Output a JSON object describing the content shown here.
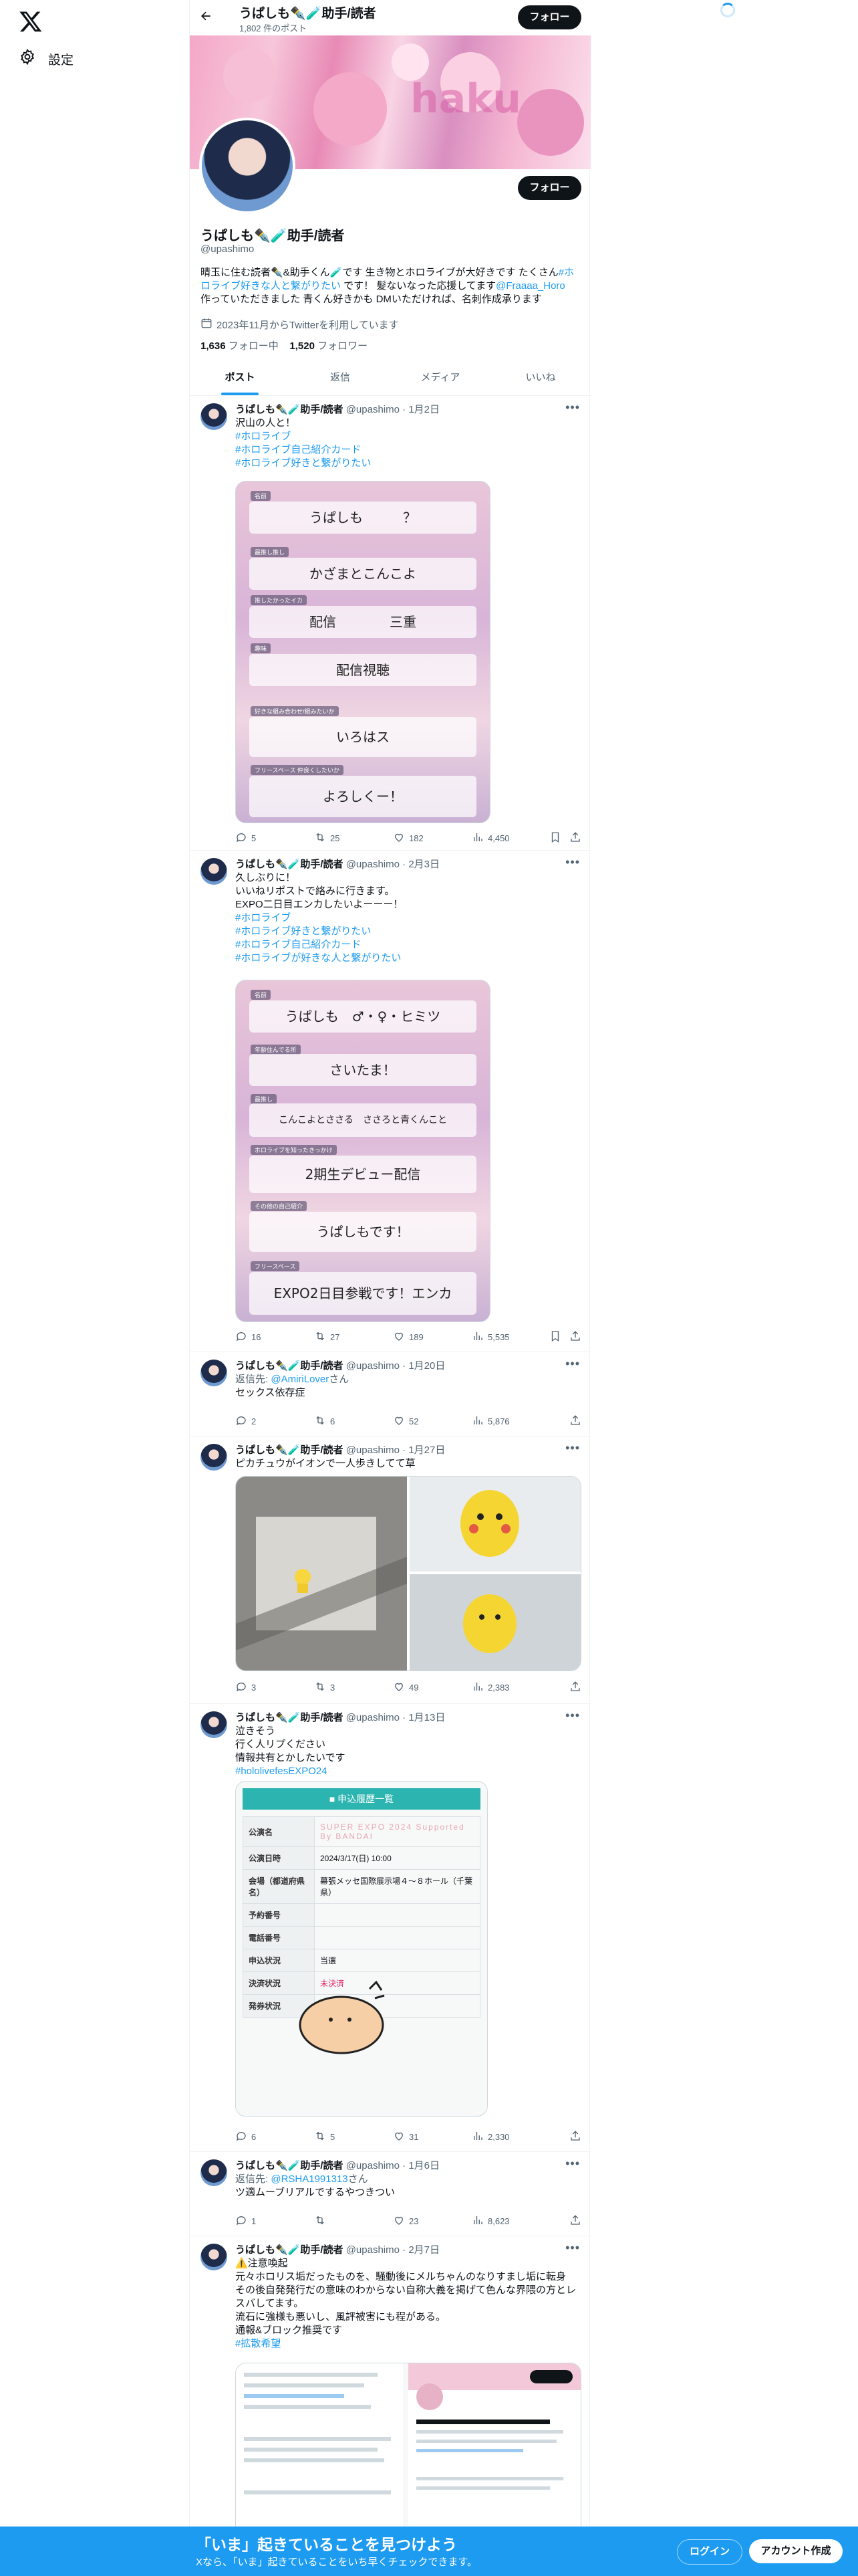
{
  "nav": {
    "settings_label": "設定"
  },
  "header": {
    "name": "うぱしも✒️🧪助手/読者",
    "posts_count": "1,802 件のポスト",
    "follow_label": "フォロー"
  },
  "profile": {
    "name": "うぱしも✒️🧪助手/読者",
    "handle": "@upashimo",
    "bio_1": "晴玉に住む読者✒️&助手くん🧪です 生き物とホロライブが大好きです たくさん",
    "bio_tag": "#ホロライブ好きな人と繋がりたい",
    "bio_2": " です！ 髪ないなった応援してます",
    "bio_mention": "@Fraaaa_Horo",
    "bio_3": "作っていただきました 青くん好きかも DMいただければ、名刺作成承ります",
    "joined": "2023年11月からTwitterを利用しています",
    "following_count": "1,636",
    "following_label": "フォロー中",
    "followers_count": "1,520",
    "followers_label": "フォロワー",
    "follow_label": "フォロー"
  },
  "tabs": [
    "ポスト",
    "返信",
    "メディア",
    "いいね"
  ],
  "tweets": [
    {
      "name": "うぱしも✒️🧪助手/読者",
      "handle": "@upashimo",
      "date": "· 1月2日",
      "text": "沢山の人と！",
      "tags": [
        "#ホロライブ",
        "#ホロライブ自己紹介カード",
        "#ホロライブ好きと繋がりたい"
      ],
      "card": {
        "rows": [
          {
            "label": "名前",
            "value": "うぱしも　　　？"
          },
          {
            "label": "最推し推し",
            "value": "かざまとこんこよ"
          },
          {
            "label": "推したかったイカ",
            "value": "配信　　　　三重"
          },
          {
            "label": "趣味",
            "value": "配信視聴"
          },
          {
            "label": "好きな組み合わせ/組みたいか",
            "value": "いろはス"
          },
          {
            "label": "フリースペース 仲良くしたいか",
            "value": "よろしくー！"
          }
        ]
      },
      "replies": "5",
      "reposts": "25",
      "likes": "182",
      "views": "4,450"
    },
    {
      "name": "うぱしも✒️🧪助手/読者",
      "handle": "@upashimo",
      "date": "· 2月3日",
      "text": "久しぶりに！\nいいねリポストで絡みに行きます。\nEXPO二日目エンカしたいよーーー！",
      "tags": [
        "#ホロライブ",
        "#ホロライブ好きと繋がりたい",
        "#ホロライブ自己紹介カード",
        "#ホロライブが好きな人と繋がりたい"
      ],
      "card": {
        "rows": [
          {
            "label": "名前",
            "value": "うぱしも　♂・♀・ヒミツ"
          },
          {
            "label": "年齢住んでる所",
            "value": "さいたま！"
          },
          {
            "label": "最推し",
            "value": "こんこよとささる　ささろと青くんこと"
          },
          {
            "label": "ホロライブを知ったきっかけ",
            "value": "2期生デビュー配信"
          },
          {
            "label": "その他の自己紹介",
            "value": "うぱしもです！"
          },
          {
            "label": "フリースペース",
            "value": "EXPO2日目参戦です！エンカ"
          }
        ]
      },
      "replies": "16",
      "reposts": "27",
      "likes": "189",
      "views": "5,535"
    },
    {
      "name": "うぱしも✒️🧪助手/読者",
      "handle": "@upashimo",
      "date": "· 1月20日",
      "reply_prefix": "返信先: ",
      "reply_to": "@AmiriLover",
      "reply_suffix": "さん",
      "text": "セックス依存症",
      "replies": "2",
      "reposts": "6",
      "likes": "52",
      "views": "5,876"
    },
    {
      "name": "うぱしも✒️🧪助手/読者",
      "handle": "@upashimo",
      "date": "· 1月27日",
      "text": "ピカチュウがイオンで一人歩きしてて草",
      "replies": "3",
      "reposts": "3",
      "likes": "49",
      "views": "2,383"
    },
    {
      "name": "うぱしも✒️🧪助手/読者",
      "handle": "@upashimo",
      "date": "· 1月13日",
      "text": "泣きそう\n行く人リプください\n情報共有とかしたいです",
      "tags": [
        "#hololivefesEXPO24"
      ],
      "apply": {
        "title": "申込履歴一覧",
        "rows": [
          {
            "k": "公演名",
            "v": "SUPER EXPO 2024 Supported By BANDAI"
          },
          {
            "k": "公演日時",
            "v": "2024/3/17(日) 10:00"
          },
          {
            "k": "会場（都道府県名）",
            "v": "幕張メッセ国際展示場４～８ホール（千葉県）"
          },
          {
            "k": "予約番号",
            "v": ""
          },
          {
            "k": "電話番号",
            "v": ""
          },
          {
            "k": "申込状況",
            "v": "当選"
          },
          {
            "k": "決済状況",
            "v": "未決済"
          },
          {
            "k": "発券状況",
            "v": ""
          }
        ]
      },
      "replies": "6",
      "reposts": "5",
      "likes": "31",
      "views": "2,330"
    },
    {
      "name": "うぱしも✒️🧪助手/読者",
      "handle": "@upashimo",
      "date": "· 1月6日",
      "reply_prefix": "返信先: ",
      "reply_to": "@RSHA1991313",
      "reply_suffix": "さん",
      "text": "ツ適ムーブリアルでするやつきつい",
      "replies": "1",
      "reposts": "",
      "likes": "23",
      "views": "8,623"
    },
    {
      "name": "うぱしも✒️🧪助手/読者",
      "handle": "@upashimo",
      "date": "· 2月7日",
      "text": "⚠️注意喚起\n元々ホロリス垢だったものを、騒動後にメルちゃんのなりすまし垢に転身\nその後自発発行だの意味のわからない自称大義を掲げて色んな界隈の方とレスバしてます。\n流石に強様も悪いし、風評被害にも程がある。\n通報&ブロック推奨です",
      "tags": [
        "#拡散希望"
      ],
      "replies": "",
      "reposts": "",
      "likes": "",
      "views": ""
    }
  ],
  "bottom_bar": {
    "title": "「いま」起きていることを見つけよう",
    "subtitle": "Xなら、「いま」起きていることをいち早くチェックできます。",
    "login_label": "ログイン",
    "signup_label": "アカウント作成"
  }
}
